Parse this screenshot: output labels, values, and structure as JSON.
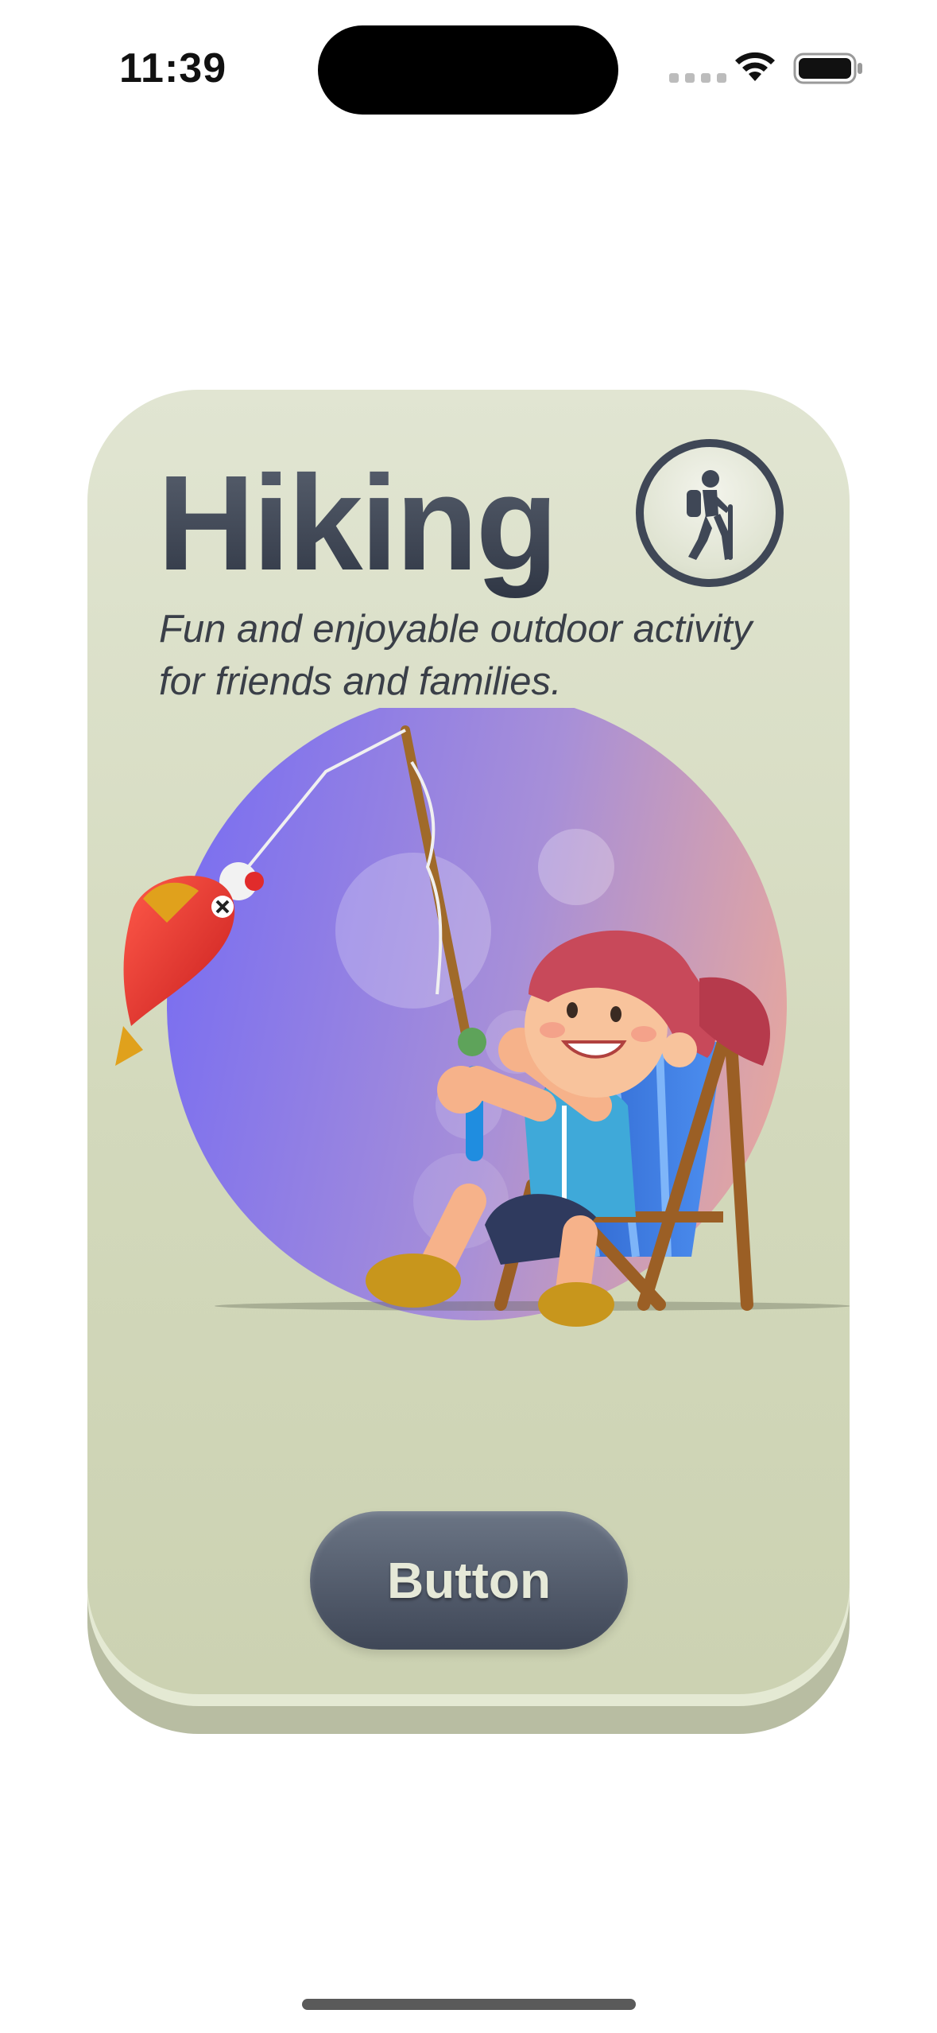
{
  "status_bar": {
    "time": "11:39"
  },
  "card": {
    "title": "Hiking",
    "subtitle": "Fun and enjoyable outdoor activity for friends and families.",
    "badge_icon": "hiking-person-icon",
    "illustration": "girl-fishing-on-deck-chair",
    "button_label": "Button"
  },
  "colors": {
    "card_background": "#d8dec5",
    "title_text": "#424a58",
    "button_background": "#4f5868",
    "button_text": "#e6e9d8",
    "circle_gradient_start": "#7b6ff0",
    "circle_gradient_end": "#e4a6a0"
  }
}
